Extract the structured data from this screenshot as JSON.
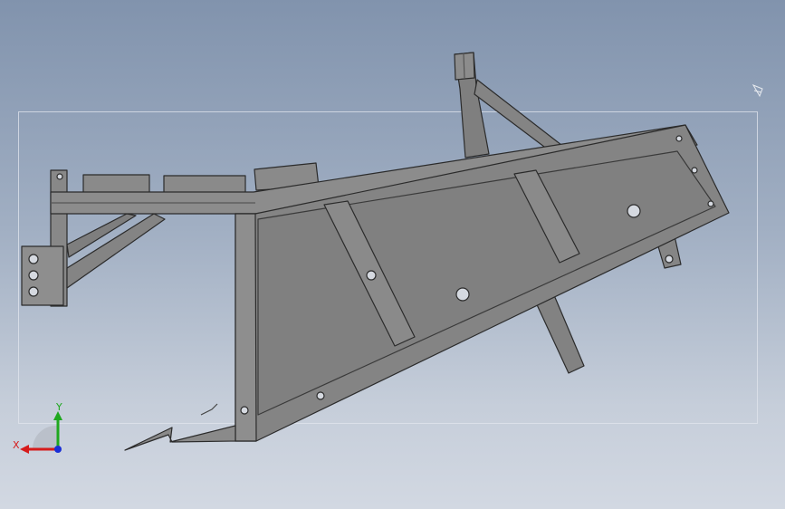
{
  "viewport": {
    "background_top": "#8193ad",
    "background_bottom": "#d2d8e2",
    "part_fill": "#878787",
    "part_edge": "#2a2a2a"
  },
  "triad": {
    "x_label": "X",
    "y_label": "Y",
    "x_color": "#d61b1b",
    "y_color": "#1fa81f",
    "z_color": "#1a2fd6"
  },
  "icons": {
    "corner": "view-orientation-icon"
  }
}
